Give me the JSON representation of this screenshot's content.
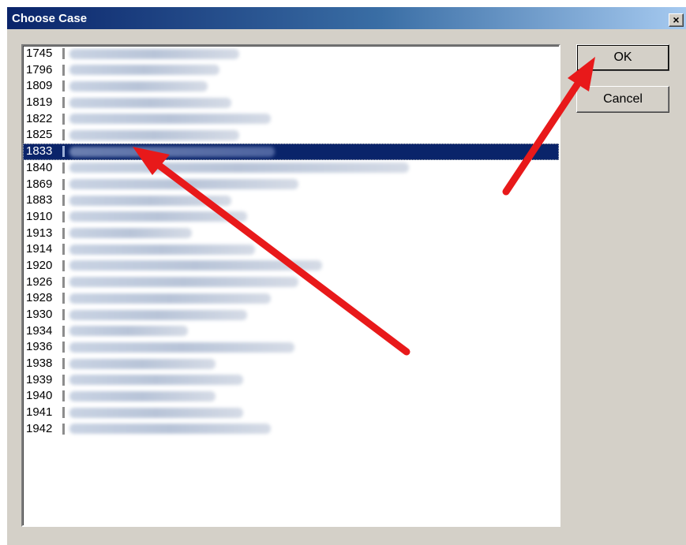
{
  "dialog": {
    "title": "Choose Case",
    "close_label": "×"
  },
  "buttons": {
    "ok": "OK",
    "cancel": "Cancel"
  },
  "case_list": {
    "selected_index": 6,
    "items": [
      {
        "number": "1745"
      },
      {
        "number": "1796"
      },
      {
        "number": "1809"
      },
      {
        "number": "1819"
      },
      {
        "number": "1822"
      },
      {
        "number": "1825"
      },
      {
        "number": "1833"
      },
      {
        "number": "1840"
      },
      {
        "number": "1869"
      },
      {
        "number": "1883"
      },
      {
        "number": "1910"
      },
      {
        "number": "1913"
      },
      {
        "number": "1914"
      },
      {
        "number": "1920"
      },
      {
        "number": "1926"
      },
      {
        "number": "1928"
      },
      {
        "number": "1930"
      },
      {
        "number": "1934"
      },
      {
        "number": "1936"
      },
      {
        "number": "1938"
      },
      {
        "number": "1939"
      },
      {
        "number": "1940"
      },
      {
        "number": "1941"
      },
      {
        "number": "1942"
      }
    ]
  },
  "annotation_color": "#e8191a"
}
